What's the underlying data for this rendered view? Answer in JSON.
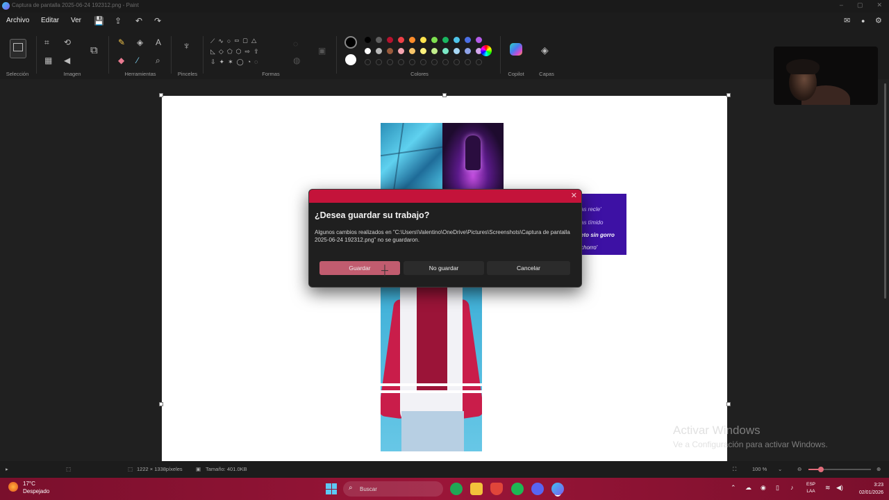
{
  "window": {
    "title": "Captura de pantalla 2025-06-24 192312.png - Paint",
    "controls": [
      "–",
      "▢",
      "✕"
    ]
  },
  "menu": {
    "file": "Archivo",
    "edit": "Editar",
    "view": "Ver"
  },
  "toolbar": {
    "groups": {
      "selection": "Selección",
      "image": "Imagen",
      "tools": "Herramientas",
      "brushes": "Pinceles",
      "shapes": "Formas",
      "colors": "Colores",
      "copilot": "Copilot",
      "layers": "Capas"
    },
    "palette": [
      "#000000",
      "#5f5f5f",
      "#b5122e",
      "#ef4046",
      "#ff8c2a",
      "#ffe34d",
      "#7ee04f",
      "#19b660",
      "#4ec5ea",
      "#4b6fe5",
      "#b45be8",
      "#ffffff",
      "#b9b9b9",
      "#9a5a3c",
      "#f5a5b0",
      "#f7c56a",
      "#fff27e",
      "#c2ee8c",
      "#7ae8c6",
      "#a7d8f5",
      "#8fa3e8",
      "#d6a7ee"
    ]
  },
  "canvas_text": {
    "purple_lines": [
      "as recle'",
      "as tímido",
      "eto sin gorro",
      "chorro'"
    ]
  },
  "dialog": {
    "title": "¿Desea guardar su trabajo?",
    "message": "Algunos cambios realizados en \"C:\\Users\\Valentino\\OneDrive\\Pictures\\Screenshots\\Captura de pantalla 2025-06-24 192312.png\" no se guardaron.",
    "buttons": {
      "save": "Guardar",
      "dont_save": "No guardar",
      "cancel": "Cancelar"
    },
    "close": "✕"
  },
  "watermark": {
    "line1": "Activar Windows",
    "line2": "Ve a Configuración para activar Windows."
  },
  "status": {
    "dimensions": "1222 × 1338píxeles",
    "size": "Tamaño: 401.0KB",
    "zoom": "100 %",
    "zoom_fraction": 0.2
  },
  "taskbar": {
    "weather_temp": "17°C",
    "weather_desc": "Despejado",
    "search_placeholder": "Buscar",
    "lang_line1": "ESP",
    "lang_line2": "LAA",
    "time": "3:23",
    "date": "02/01/2026"
  }
}
